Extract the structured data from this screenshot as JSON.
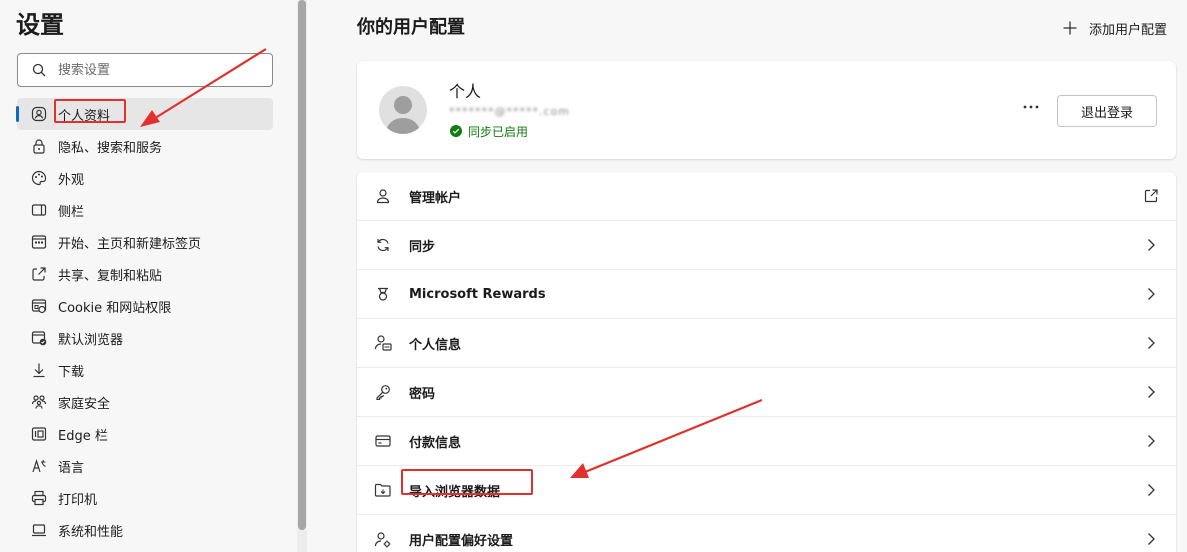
{
  "sidebar": {
    "title": "设置",
    "search_placeholder": "搜索设置",
    "items": [
      {
        "label": "个人资料",
        "icon": "profile-icon",
        "active": true
      },
      {
        "label": "隐私、搜索和服务",
        "icon": "lock-icon"
      },
      {
        "label": "外观",
        "icon": "palette-icon"
      },
      {
        "label": "侧栏",
        "icon": "sidebar-icon"
      },
      {
        "label": "开始、主页和新建标签页",
        "icon": "home-grid-icon"
      },
      {
        "label": "共享、复制和粘贴",
        "icon": "share-icon"
      },
      {
        "label": "Cookie 和网站权限",
        "icon": "cookie-icon"
      },
      {
        "label": "默认浏览器",
        "icon": "browser-icon"
      },
      {
        "label": "下载",
        "icon": "download-icon"
      },
      {
        "label": "家庭安全",
        "icon": "family-icon"
      },
      {
        "label": "Edge 栏",
        "icon": "edge-bar-icon"
      },
      {
        "label": "语言",
        "icon": "language-icon"
      },
      {
        "label": "打印机",
        "icon": "printer-icon"
      },
      {
        "label": "系统和性能",
        "icon": "laptop-icon"
      }
    ]
  },
  "main": {
    "title": "你的用户配置",
    "add_profile_label": "添加用户配置",
    "profile": {
      "name": "个人",
      "email": "*******@*****.com",
      "sync_status": "同步已启用",
      "signout_label": "退出登录"
    },
    "rows": [
      {
        "label": "管理帐户",
        "icon": "account-icon",
        "trail": "external-link-icon"
      },
      {
        "label": "同步",
        "icon": "sync-icon",
        "trail": "chevron-right-icon"
      },
      {
        "label": "Microsoft Rewards",
        "icon": "trophy-icon",
        "trail": "chevron-right-icon"
      },
      {
        "label": "个人信息",
        "icon": "personal-info-icon",
        "trail": "chevron-right-icon"
      },
      {
        "label": "密码",
        "icon": "key-icon",
        "trail": "chevron-right-icon"
      },
      {
        "label": "付款信息",
        "icon": "card-icon",
        "trail": "chevron-right-icon"
      },
      {
        "label": "导入浏览器数据",
        "icon": "import-folder-icon",
        "trail": "chevron-right-icon"
      },
      {
        "label": "用户配置偏好设置",
        "icon": "profile-settings-icon",
        "trail": "chevron-right-icon"
      }
    ]
  },
  "colors": {
    "accent": "#0f6cbd",
    "sync_green": "#107c10",
    "annotation_red": "#e0312e"
  }
}
